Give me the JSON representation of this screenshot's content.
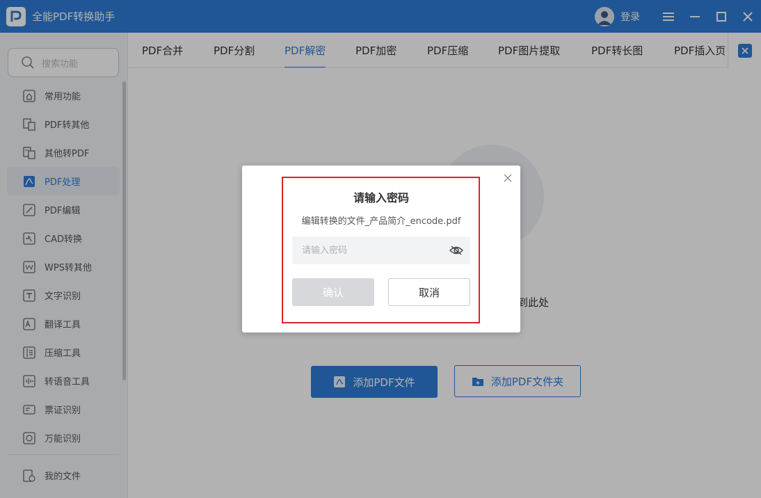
{
  "app": {
    "title": "全能PDF转换助手",
    "login_label": "登录",
    "logo_letter": "P",
    "brand_color": "#2f7bd6"
  },
  "window_controls": {
    "menu_icon": "menu-icon",
    "minimize_icon": "minimize-icon",
    "maximize_icon": "maximize-icon",
    "close_icon": "close-icon"
  },
  "sidebar": {
    "search_placeholder": "搜索功能",
    "items": [
      {
        "label": "常用功能",
        "icon": "home-icon",
        "active": false
      },
      {
        "label": "PDF转其他",
        "icon": "pdf-to-other-icon",
        "active": false
      },
      {
        "label": "其他转PDF",
        "icon": "other-to-pdf-icon",
        "active": false
      },
      {
        "label": "PDF处理",
        "icon": "pdf-process-icon",
        "active": true
      },
      {
        "label": "PDF编辑",
        "icon": "pdf-edit-icon",
        "active": false
      },
      {
        "label": "CAD转换",
        "icon": "cad-icon",
        "active": false
      },
      {
        "label": "WPS转其他",
        "icon": "wps-icon",
        "active": false
      },
      {
        "label": "文字识别",
        "icon": "ocr-icon",
        "active": false
      },
      {
        "label": "翻译工具",
        "icon": "translate-icon",
        "active": false
      },
      {
        "label": "压缩工具",
        "icon": "compress-icon",
        "active": false
      },
      {
        "label": "转语音工具",
        "icon": "voice-icon",
        "active": false
      },
      {
        "label": "票证识别",
        "icon": "ticket-icon",
        "active": false
      },
      {
        "label": "万能识别",
        "icon": "universal-icon",
        "active": false
      }
    ],
    "my_files": "我的文件"
  },
  "tabs": [
    {
      "label": "PDF合并",
      "active": false
    },
    {
      "label": "PDF分割",
      "active": false
    },
    {
      "label": "PDF解密",
      "active": true
    },
    {
      "label": "PDF加密",
      "active": false
    },
    {
      "label": "PDF压缩",
      "active": false
    },
    {
      "label": "PDF图片提取",
      "active": false
    },
    {
      "label": "PDF转长图",
      "active": false
    },
    {
      "label": "PDF插入页",
      "active": false
    }
  ],
  "main": {
    "drop_text_visible": "到此处",
    "add_file_button": "添加PDF文件",
    "add_folder_button": "添加PDF文件夹"
  },
  "dialog": {
    "title": "请输入密码",
    "filename": "编辑转换的文件_产品简介_encode.pdf",
    "password_placeholder": "请输入密码",
    "password_value": "",
    "confirm_label": "确认",
    "cancel_label": "取消",
    "highlight_color": "#d9232a"
  }
}
